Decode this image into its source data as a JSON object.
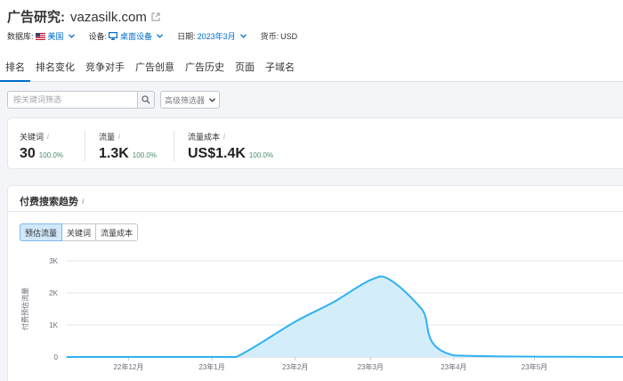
{
  "header": {
    "title_prefix": "广告研究:",
    "domain": "vazasilk.com"
  },
  "meta": {
    "database_label": "数据库:",
    "database_value": "美国",
    "device_label": "设备:",
    "device_value": "桌面设备",
    "date_label": "日期:",
    "date_value": "2023年3月",
    "currency_label": "货币:",
    "currency_value": "USD"
  },
  "tabs": [
    {
      "label": "排名",
      "active": true
    },
    {
      "label": "排名变化"
    },
    {
      "label": "竞争对手"
    },
    {
      "label": "广告创意"
    },
    {
      "label": "广告历史"
    },
    {
      "label": "页面"
    },
    {
      "label": "子域名"
    }
  ],
  "filters": {
    "search_placeholder": "按关键词筛选",
    "advanced_label": "高级筛选器"
  },
  "stats": [
    {
      "label": "关键词",
      "info": "i",
      "value": "30",
      "pct": "100.0%"
    },
    {
      "label": "流量",
      "info": "i",
      "value": "1.3K",
      "pct": "100.0%"
    },
    {
      "label": "流量成本",
      "info": "i",
      "value": "US$1.4K",
      "pct": "100.0%"
    }
  ],
  "trend": {
    "title": "付费搜索趋势",
    "info": "i",
    "toggles": [
      {
        "label": "预估流量",
        "active": true
      },
      {
        "label": "关键词"
      },
      {
        "label": "流量成本"
      }
    ]
  },
  "colors": {
    "accent": "#006dca",
    "line": "#2fb1f2",
    "fill": "#d4edfb",
    "positive": "#4a8c6a"
  },
  "chart_data": {
    "type": "area",
    "ylabel": "付费预估流量",
    "yticks": [
      "0",
      "1K",
      "2K",
      "3K"
    ],
    "ylim": [
      0,
      3000
    ],
    "xticks": [
      "22年12月",
      "23年1月",
      "23年2月",
      "23年3月",
      "23年4月",
      "23年5月"
    ],
    "grid": true,
    "points": [
      {
        "x": "2022-11-08",
        "y": 0
      },
      {
        "x": "2023-01-01",
        "y": 0
      },
      {
        "x": "2023-01-10",
        "y": 0
      },
      {
        "x": "2023-02-01",
        "y": 1100
      },
      {
        "x": "2023-02-15",
        "y": 1700
      },
      {
        "x": "2023-03-01",
        "y": 2400
      },
      {
        "x": "2023-03-08",
        "y": 2420
      },
      {
        "x": "2023-03-20",
        "y": 1500
      },
      {
        "x": "2023-04-01",
        "y": 50
      },
      {
        "x": "2023-06-05",
        "y": 0
      }
    ]
  }
}
